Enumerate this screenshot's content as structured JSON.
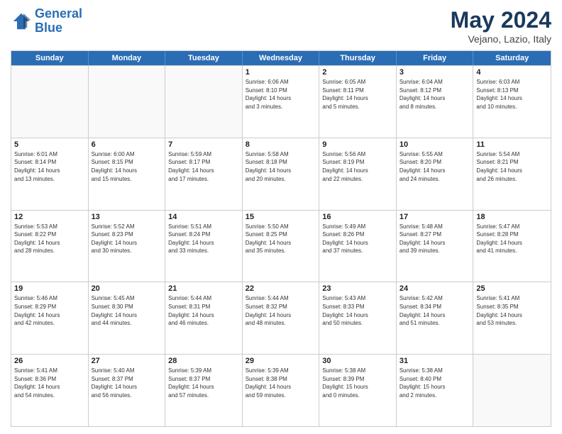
{
  "header": {
    "logo_line1": "General",
    "logo_line2": "Blue",
    "month_title": "May 2024",
    "location": "Vejano, Lazio, Italy"
  },
  "weekdays": [
    "Sunday",
    "Monday",
    "Tuesday",
    "Wednesday",
    "Thursday",
    "Friday",
    "Saturday"
  ],
  "rows": [
    [
      {
        "day": "",
        "info": "",
        "empty": true
      },
      {
        "day": "",
        "info": "",
        "empty": true
      },
      {
        "day": "",
        "info": "",
        "empty": true
      },
      {
        "day": "1",
        "info": "Sunrise: 6:06 AM\nSunset: 8:10 PM\nDaylight: 14 hours\nand 3 minutes."
      },
      {
        "day": "2",
        "info": "Sunrise: 6:05 AM\nSunset: 8:11 PM\nDaylight: 14 hours\nand 5 minutes."
      },
      {
        "day": "3",
        "info": "Sunrise: 6:04 AM\nSunset: 8:12 PM\nDaylight: 14 hours\nand 8 minutes."
      },
      {
        "day": "4",
        "info": "Sunrise: 6:03 AM\nSunset: 8:13 PM\nDaylight: 14 hours\nand 10 minutes."
      }
    ],
    [
      {
        "day": "5",
        "info": "Sunrise: 6:01 AM\nSunset: 8:14 PM\nDaylight: 14 hours\nand 13 minutes."
      },
      {
        "day": "6",
        "info": "Sunrise: 6:00 AM\nSunset: 8:15 PM\nDaylight: 14 hours\nand 15 minutes."
      },
      {
        "day": "7",
        "info": "Sunrise: 5:59 AM\nSunset: 8:17 PM\nDaylight: 14 hours\nand 17 minutes."
      },
      {
        "day": "8",
        "info": "Sunrise: 5:58 AM\nSunset: 8:18 PM\nDaylight: 14 hours\nand 20 minutes."
      },
      {
        "day": "9",
        "info": "Sunrise: 5:56 AM\nSunset: 8:19 PM\nDaylight: 14 hours\nand 22 minutes."
      },
      {
        "day": "10",
        "info": "Sunrise: 5:55 AM\nSunset: 8:20 PM\nDaylight: 14 hours\nand 24 minutes."
      },
      {
        "day": "11",
        "info": "Sunrise: 5:54 AM\nSunset: 8:21 PM\nDaylight: 14 hours\nand 26 minutes."
      }
    ],
    [
      {
        "day": "12",
        "info": "Sunrise: 5:53 AM\nSunset: 8:22 PM\nDaylight: 14 hours\nand 28 minutes."
      },
      {
        "day": "13",
        "info": "Sunrise: 5:52 AM\nSunset: 8:23 PM\nDaylight: 14 hours\nand 30 minutes."
      },
      {
        "day": "14",
        "info": "Sunrise: 5:51 AM\nSunset: 8:24 PM\nDaylight: 14 hours\nand 33 minutes."
      },
      {
        "day": "15",
        "info": "Sunrise: 5:50 AM\nSunset: 8:25 PM\nDaylight: 14 hours\nand 35 minutes."
      },
      {
        "day": "16",
        "info": "Sunrise: 5:49 AM\nSunset: 8:26 PM\nDaylight: 14 hours\nand 37 minutes."
      },
      {
        "day": "17",
        "info": "Sunrise: 5:48 AM\nSunset: 8:27 PM\nDaylight: 14 hours\nand 39 minutes."
      },
      {
        "day": "18",
        "info": "Sunrise: 5:47 AM\nSunset: 8:28 PM\nDaylight: 14 hours\nand 41 minutes."
      }
    ],
    [
      {
        "day": "19",
        "info": "Sunrise: 5:46 AM\nSunset: 8:29 PM\nDaylight: 14 hours\nand 42 minutes."
      },
      {
        "day": "20",
        "info": "Sunrise: 5:45 AM\nSunset: 8:30 PM\nDaylight: 14 hours\nand 44 minutes."
      },
      {
        "day": "21",
        "info": "Sunrise: 5:44 AM\nSunset: 8:31 PM\nDaylight: 14 hours\nand 46 minutes."
      },
      {
        "day": "22",
        "info": "Sunrise: 5:44 AM\nSunset: 8:32 PM\nDaylight: 14 hours\nand 48 minutes."
      },
      {
        "day": "23",
        "info": "Sunrise: 5:43 AM\nSunset: 8:33 PM\nDaylight: 14 hours\nand 50 minutes."
      },
      {
        "day": "24",
        "info": "Sunrise: 5:42 AM\nSunset: 8:34 PM\nDaylight: 14 hours\nand 51 minutes."
      },
      {
        "day": "25",
        "info": "Sunrise: 5:41 AM\nSunset: 8:35 PM\nDaylight: 14 hours\nand 53 minutes."
      }
    ],
    [
      {
        "day": "26",
        "info": "Sunrise: 5:41 AM\nSunset: 8:36 PM\nDaylight: 14 hours\nand 54 minutes."
      },
      {
        "day": "27",
        "info": "Sunrise: 5:40 AM\nSunset: 8:37 PM\nDaylight: 14 hours\nand 56 minutes."
      },
      {
        "day": "28",
        "info": "Sunrise: 5:39 AM\nSunset: 8:37 PM\nDaylight: 14 hours\nand 57 minutes."
      },
      {
        "day": "29",
        "info": "Sunrise: 5:39 AM\nSunset: 8:38 PM\nDaylight: 14 hours\nand 59 minutes."
      },
      {
        "day": "30",
        "info": "Sunrise: 5:38 AM\nSunset: 8:39 PM\nDaylight: 15 hours\nand 0 minutes."
      },
      {
        "day": "31",
        "info": "Sunrise: 5:38 AM\nSunset: 8:40 PM\nDaylight: 15 hours\nand 2 minutes."
      },
      {
        "day": "",
        "info": "",
        "empty": true
      }
    ]
  ]
}
